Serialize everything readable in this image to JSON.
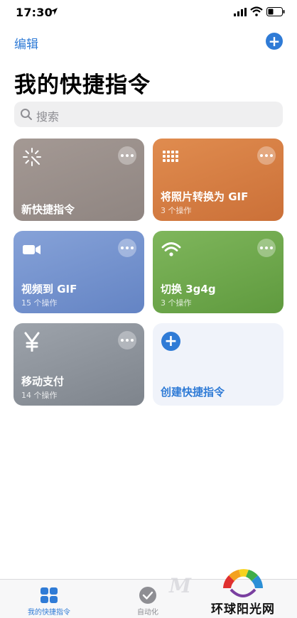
{
  "status": {
    "time": "17:30"
  },
  "nav": {
    "edit_label": "编辑",
    "add_label": "+"
  },
  "page": {
    "title": "我的快捷指令"
  },
  "search": {
    "placeholder": "搜索"
  },
  "shortcuts": [
    {
      "name": "新快捷指令",
      "actions": "",
      "color": "#9a8f8b",
      "icon": "sparkle-icon"
    },
    {
      "name": "将照片转换为 GIF",
      "actions": "3 个操作",
      "color": "#d67c44",
      "icon": "grid-icon"
    },
    {
      "name": "视频到 GIF",
      "actions": "15 个操作",
      "color": "#7593ce",
      "icon": "video-camera-icon"
    },
    {
      "name": "切换 3g4g",
      "actions": "3 个操作",
      "color": "#6fa84d",
      "icon": "wifi-icon"
    },
    {
      "name": "移动支付",
      "actions": "14 个操作",
      "color": "#8d939b",
      "icon": "yen-icon"
    }
  ],
  "create": {
    "label": "创建快捷指令"
  },
  "tabs": [
    {
      "label": "我的快捷指令",
      "icon": "shortcuts-grid-icon",
      "selected": true
    },
    {
      "label": "自动化",
      "icon": "automation-check-icon",
      "selected": false
    }
  ],
  "watermark": {
    "brand": "环球阳光网",
    "letter": "M"
  },
  "colors": {
    "accent": "#2f7bd6"
  }
}
